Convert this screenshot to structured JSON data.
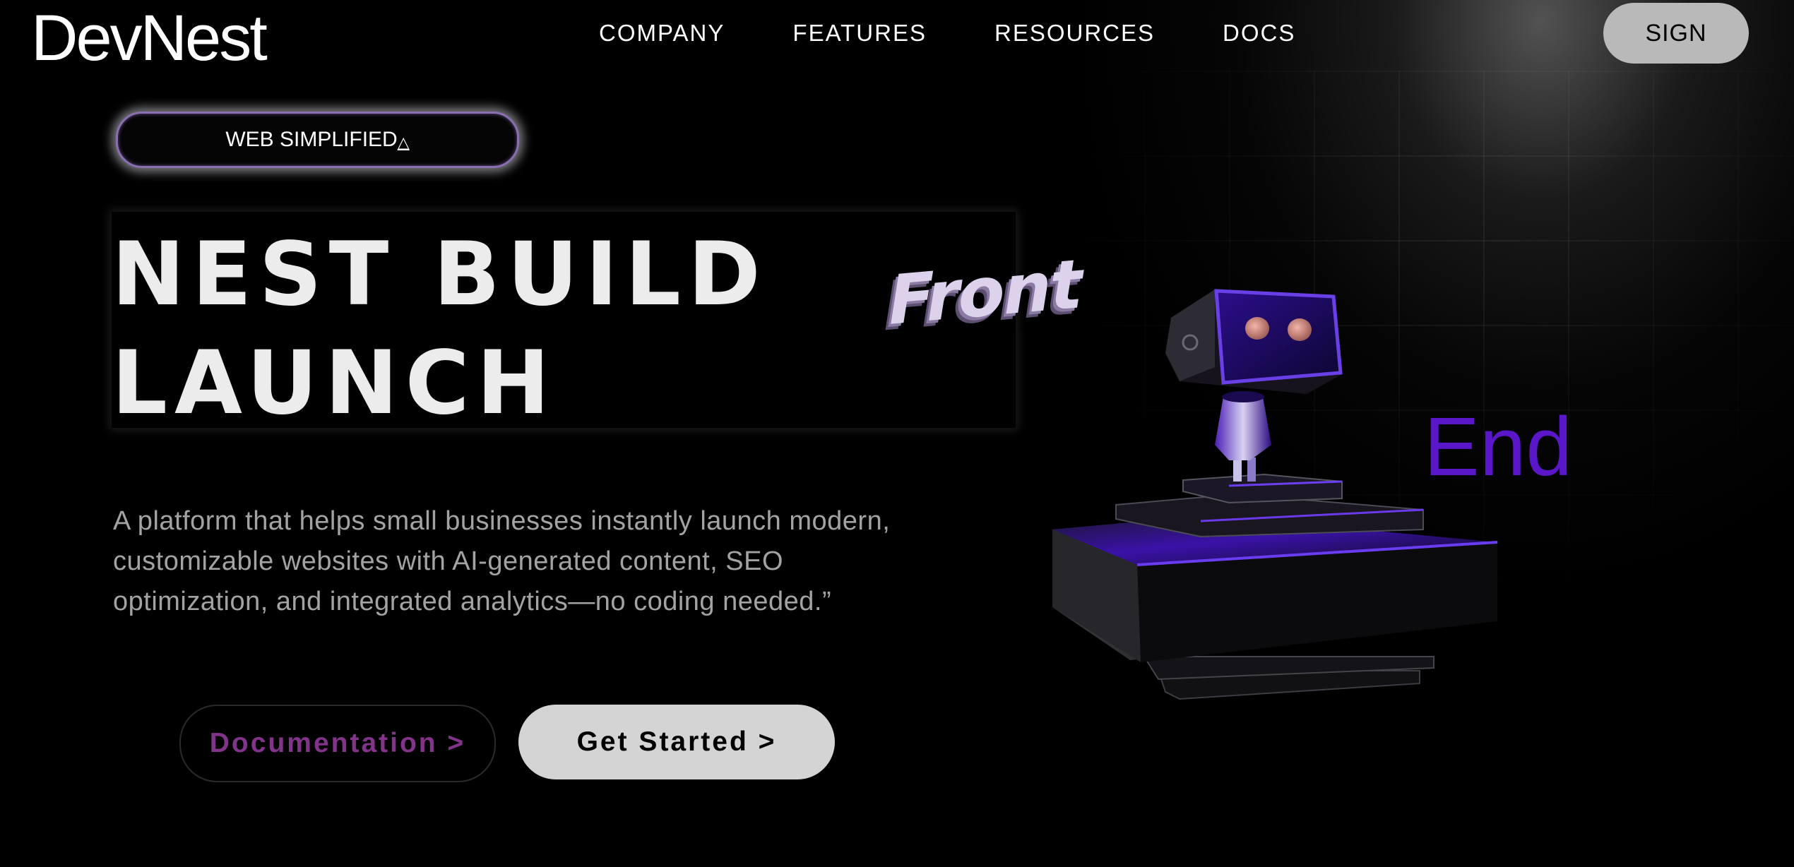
{
  "brand": {
    "logo_text": "DevNest"
  },
  "nav": {
    "items": [
      {
        "label": "COMPANY"
      },
      {
        "label": "FEATURES"
      },
      {
        "label": "RESOURCES"
      },
      {
        "label": "DOCS"
      }
    ],
    "sign_label": "SIGN"
  },
  "hero": {
    "badge_label": "WEB SIMPLIFIED",
    "badge_glyph": "△",
    "headline_line1": "NEST BUILD",
    "headline_line2": "LAUNCH",
    "floating_word_front": "Front",
    "floating_word_end": "End",
    "description": "A platform that helps small businesses instantly launch modern, customizable websites with AI-generated content, SEO optimization, and integrated analytics—no coding needed.”",
    "doc_button_label": "Documentation >",
    "start_button_label": "Get Started >"
  },
  "illustration": {
    "icon": "robot-on-podium-icon"
  },
  "colors": {
    "background": "#000000",
    "accent_purple": "#5a16c9",
    "doc_button_text": "#82338a",
    "sign_button_bg": "#b9b9b9",
    "start_button_bg": "#d4d4d4"
  }
}
